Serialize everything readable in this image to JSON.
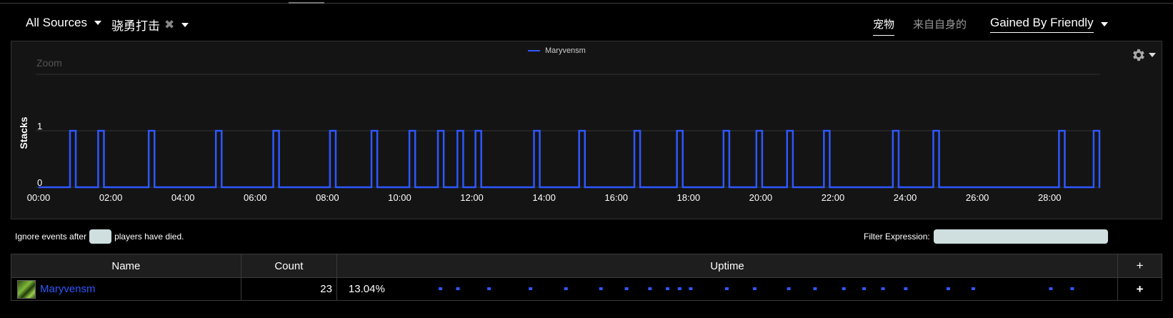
{
  "toolbar": {
    "source_dropdown": "All Sources",
    "ability_dropdown": "骁勇打击",
    "remove_glyph": "✖",
    "view_pets": "宠物",
    "view_self": "来自自身的",
    "gained_dropdown": "Gained By Friendly"
  },
  "chart": {
    "zoom_label": "Zoom",
    "settings_icon": "gear-icon"
  },
  "chart_data": {
    "type": "line",
    "title": "",
    "xlabel": "",
    "ylabel": "Stacks",
    "xlim_min": [
      0,
      29.4
    ],
    "ylim": [
      0,
      1.5
    ],
    "y_ticks": [
      "0",
      "1"
    ],
    "x_ticks": [
      "00:00",
      "02:00",
      "04:00",
      "06:00",
      "08:00",
      "10:00",
      "12:00",
      "14:00",
      "16:00",
      "18:00",
      "20:00",
      "22:00",
      "24:00",
      "26:00",
      "28:00"
    ],
    "legend_position": "top-center",
    "grid": true,
    "series": [
      {
        "name": "Maryvensm",
        "color": "#2e57ff",
        "step": true,
        "intervals_min": [
          [
            0.87,
            1.03
          ],
          [
            1.65,
            1.81
          ],
          [
            3.05,
            3.21
          ],
          [
            4.91,
            5.07
          ],
          [
            6.5,
            6.66
          ],
          [
            8.07,
            8.23
          ],
          [
            9.22,
            9.38
          ],
          [
            10.27,
            10.43
          ],
          [
            11.06,
            11.22
          ],
          [
            11.6,
            11.76
          ],
          [
            12.1,
            12.26
          ],
          [
            13.72,
            13.88
          ],
          [
            14.97,
            15.13
          ],
          [
            16.5,
            16.66
          ],
          [
            17.68,
            17.84
          ],
          [
            18.97,
            19.13
          ],
          [
            19.88,
            20.04
          ],
          [
            20.73,
            20.89
          ],
          [
            21.75,
            21.91
          ],
          [
            23.66,
            23.82
          ],
          [
            24.78,
            24.94
          ],
          [
            28.26,
            28.42
          ],
          [
            29.22,
            29.38
          ]
        ]
      }
    ]
  },
  "options": {
    "ignore_prefix": "Ignore events after",
    "ignore_value": "",
    "ignore_suffix": "players have died.",
    "filter_label": "Filter Expression:",
    "filter_value": ""
  },
  "table": {
    "headers": {
      "name": "Name",
      "count": "Count",
      "uptime": "Uptime",
      "expand": "+"
    },
    "rows": [
      {
        "icon": "class-spec-icon",
        "name": "Maryvensm",
        "count": "23",
        "uptime": "13.04%",
        "expand": "+",
        "bar_color": "#2e57ff"
      }
    ]
  }
}
